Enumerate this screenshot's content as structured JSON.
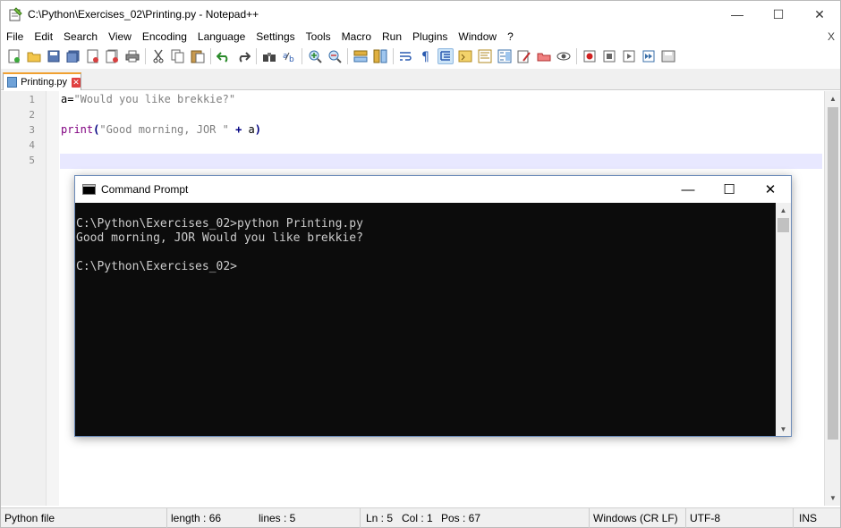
{
  "npp": {
    "title": "C:\\Python\\Exercises_02\\Printing.py - Notepad++",
    "window_controls": {
      "minimize": "—",
      "maximize": "☐",
      "close": "✕"
    },
    "menu": [
      "File",
      "Edit",
      "Search",
      "View",
      "Encoding",
      "Language",
      "Settings",
      "Tools",
      "Macro",
      "Run",
      "Plugins",
      "Window",
      "?"
    ],
    "menu_close": "X",
    "toolbar_icons": [
      "new-file-icon",
      "open-file-icon",
      "save-icon",
      "save-all-icon",
      "close-icon",
      "close-all-icon",
      "print-icon",
      "cut-icon",
      "copy-icon",
      "paste-icon",
      "undo-icon",
      "redo-icon",
      "find-icon",
      "replace-icon",
      "zoom-in-icon",
      "zoom-out-icon",
      "sync-vertical-icon",
      "sync-horizontal-icon",
      "word-wrap-icon",
      "show-all-chars-icon",
      "indent-guide-icon",
      "language-icon",
      "doc-map-icon",
      "function-list-icon",
      "folder-workspace-icon",
      "monitoring-icon",
      "record-macro-icon",
      "stop-macro-icon",
      "play-macro-icon",
      "run-macro-multiple-icon",
      "save-macro-icon"
    ],
    "tab": {
      "label": "Printing.py",
      "close": "✕"
    },
    "line_numbers": [
      "1",
      "2",
      "3",
      "4",
      "5"
    ],
    "code": {
      "line1_var": "a=",
      "line1_str": "\"Would you like brekkie?\"",
      "line3_kw": "print",
      "line3_paren_open": "(",
      "line3_str": "\"Good morning, JOR \"",
      "line3_op": " + ",
      "line3_var": "a",
      "line3_paren_close": ")"
    },
    "status": {
      "file_type": "Python file",
      "length": "length : 66",
      "lines": "lines : 5",
      "ln": "Ln : 5",
      "col": "Col : 1",
      "pos": "Pos : 67",
      "eol": "Windows (CR LF)",
      "encoding": "UTF-8",
      "mode": "INS"
    }
  },
  "cmd": {
    "title": "Command Prompt",
    "window_controls": {
      "minimize": "—",
      "maximize": "☐",
      "close": "✕"
    },
    "lines": [
      "C:\\Python\\Exercises_02>python Printing.py",
      "Good morning, JOR Would you like brekkie?",
      "",
      "C:\\Python\\Exercises_02>"
    ]
  }
}
